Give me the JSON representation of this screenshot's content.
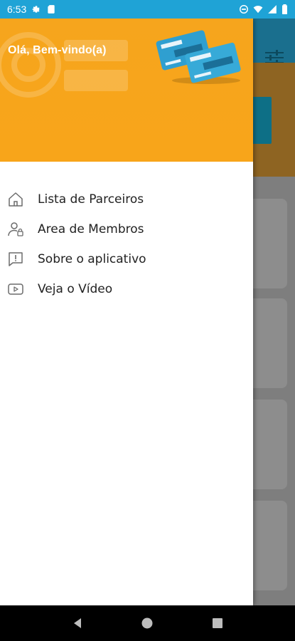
{
  "status_bar": {
    "time": "6:53",
    "icons": [
      "gear-icon",
      "sd-card-icon",
      "do-not-disturb-icon",
      "wifi-icon",
      "signal-icon",
      "battery-icon"
    ]
  },
  "drawer": {
    "greeting": "Olá, Bem-vindo(a)",
    "header_color": "#f7a51b",
    "menu_items": [
      {
        "label": "Lista de Parceiros",
        "icon": "home-icon"
      },
      {
        "label": "Area de Membros",
        "icon": "member-icon"
      },
      {
        "label": "Sobre o aplicativo",
        "icon": "info-chat-icon"
      },
      {
        "label": "Veja o Vídeo",
        "icon": "video-play-icon"
      }
    ]
  },
  "nav_bar": {
    "buttons": [
      "back-icon",
      "home-circle-icon",
      "recents-icon"
    ]
  },
  "colors": {
    "status_bar": "#1fa3d6",
    "drawer_header": "#f7a51b",
    "drawer_body": "#ffffff",
    "nav_bar": "#000000"
  }
}
